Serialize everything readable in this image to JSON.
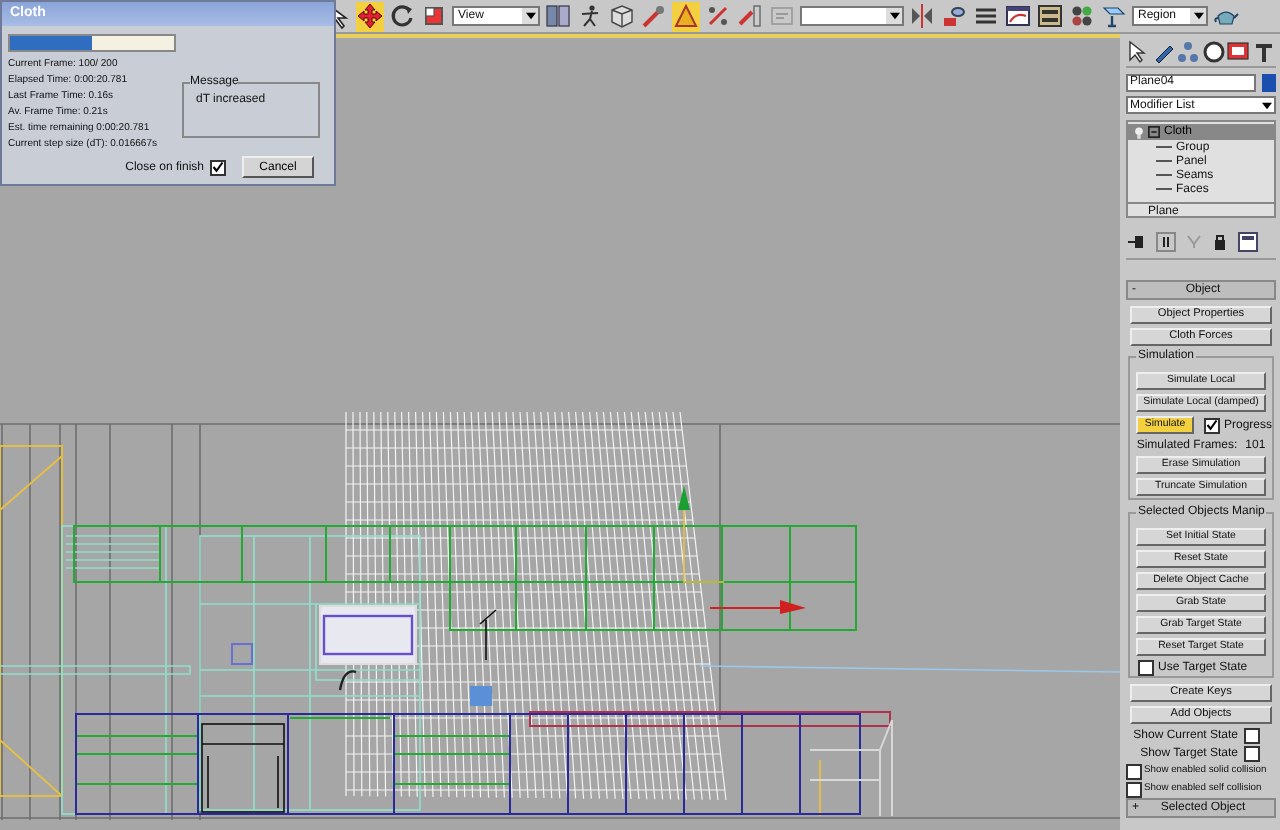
{
  "toolbar": {
    "items": [
      {
        "kind": "tool",
        "selected": false
      },
      {
        "kind": "tool",
        "selected": true
      },
      {
        "kind": "tool",
        "selected": false
      },
      {
        "kind": "tool",
        "selected": false
      },
      {
        "kind": "dropdown",
        "value": "View"
      },
      {
        "kind": "tool",
        "selected": false
      },
      {
        "kind": "tool",
        "selected": false
      },
      {
        "kind": "tool",
        "selected": false
      },
      {
        "kind": "tool",
        "selected": false
      },
      {
        "kind": "tool",
        "selected": true
      },
      {
        "kind": "tool",
        "selected": false
      },
      {
        "kind": "tool",
        "selected": false
      },
      {
        "kind": "tool",
        "selected": false
      },
      {
        "kind": "dropdown"
      },
      {
        "kind": "tool",
        "selected": false
      },
      {
        "kind": "tool",
        "selected": false
      },
      {
        "kind": "tool",
        "selected": false
      },
      {
        "kind": "tool",
        "selected": false
      },
      {
        "kind": "tool",
        "selected": false
      },
      {
        "kind": "tool",
        "selected": false
      },
      {
        "kind": "tool",
        "selected": false
      },
      {
        "kind": "dropdown",
        "value": "Region"
      },
      {
        "kind": "tool",
        "selected": false
      }
    ]
  },
  "cloth_dialog": {
    "title": "Cloth",
    "progress": {
      "level": 0.5
    },
    "lines": [
      "Current Frame: 100/ 200",
      "Elapsed Time: 0:00:20.781",
      "Last Frame Time: 0.16s",
      "Av. Frame Time: 0.21s",
      "Est. time remaining 0:00:20.781",
      "Current step size (dT): 0.016667s"
    ],
    "message": {
      "title": "Message",
      "text": "dT increased"
    },
    "close_on_finish": {
      "label": "Close on finish",
      "checked": true
    },
    "cancel": "Cancel"
  },
  "command_panel": {
    "object_name": "Plane04",
    "modifier_list": "Modifier List",
    "stack": [
      {
        "label": "Cloth",
        "selected": true,
        "expanded": true,
        "children": [
          {
            "label": "Group",
            "selected": false
          },
          {
            "label": "Panel",
            "selected": false
          },
          {
            "label": "Seams",
            "selected": false
          },
          {
            "label": "Faces",
            "selected": false
          }
        ]
      },
      {
        "label": "Plane",
        "selected": false
      }
    ],
    "rollouts": [
      {
        "sign": "-",
        "title": "Object",
        "expanded": true,
        "items": [
          {
            "kind": "button",
            "label": "Object Properties"
          },
          {
            "kind": "button",
            "label": "Cloth Forces"
          },
          {
            "kind": "group",
            "title": "Simulation",
            "items": [
              {
                "kind": "button",
                "label": "Simulate Local"
              },
              {
                "kind": "button",
                "label": "Simulate Local (damped)"
              },
              {
                "kind": "toggle",
                "label": "Simulate",
                "active": true,
                "checkbox": {
                  "label": "Progress",
                  "checked": true
                }
              },
              {
                "kind": "readout",
                "label": "Simulated Frames:",
                "value": "101"
              },
              {
                "kind": "button",
                "label": "Erase Simulation"
              },
              {
                "kind": "button",
                "label": "Truncate Simulation"
              }
            ]
          },
          {
            "kind": "group",
            "title": "Selected Objects Manip",
            "items": [
              {
                "kind": "button",
                "label": "Set Initial State"
              },
              {
                "kind": "button",
                "label": "Reset State"
              },
              {
                "kind": "button",
                "label": "Delete Object Cache"
              },
              {
                "kind": "button",
                "label": "Grab State"
              },
              {
                "kind": "button",
                "label": "Grab Target State"
              },
              {
                "kind": "button",
                "label": "Reset Target State"
              },
              {
                "kind": "checkbox",
                "label": "Use Target State",
                "checked": false
              }
            ]
          },
          {
            "kind": "button",
            "label": "Create Keys"
          },
          {
            "kind": "button",
            "label": "Add Objects"
          },
          {
            "kind": "labelcheck",
            "label": "Show Current State",
            "checked": false
          },
          {
            "kind": "labelcheck",
            "label": "Show Target State",
            "checked": false
          },
          {
            "kind": "checkbox",
            "label": "Show enabled solid collision",
            "checked": false
          },
          {
            "kind": "checkbox",
            "label": "Show enabled self collision",
            "checked": false
          }
        ]
      },
      {
        "sign": "+",
        "title": "Selected Object",
        "expanded": false
      }
    ]
  }
}
